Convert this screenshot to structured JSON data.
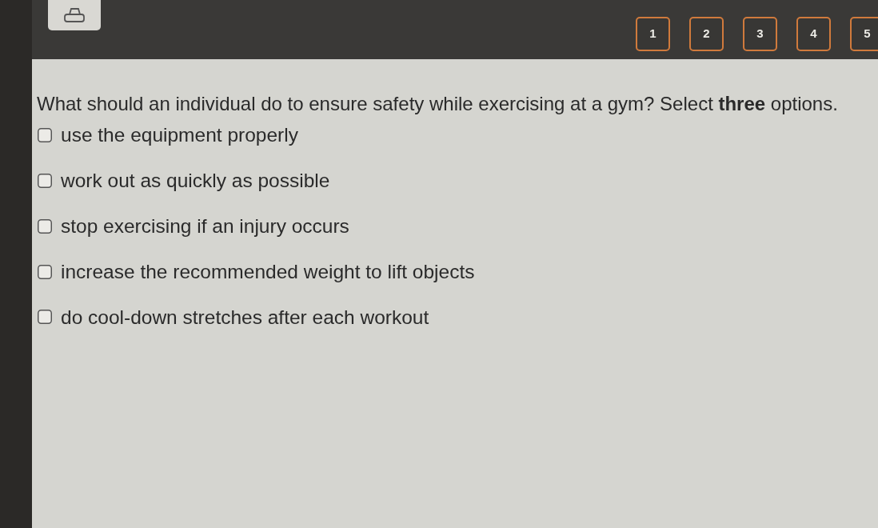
{
  "question_nav": [
    {
      "label": "1"
    },
    {
      "label": "2"
    },
    {
      "label": "3"
    },
    {
      "label": "4"
    },
    {
      "label": "5"
    }
  ],
  "question": {
    "prompt": "What should an individual do to ensure safety while exercising at a gym? Select **three** options.",
    "options": [
      {
        "text": "use the equipment properly",
        "checked": false
      },
      {
        "text": "work out as quickly as possible",
        "checked": false
      },
      {
        "text": "stop exercising if an injury occurs",
        "checked": false
      },
      {
        "text": "increase the recommended weight to lift objects",
        "checked": false
      },
      {
        "text": "do cool-down stretches after each workout",
        "checked": false
      }
    ]
  }
}
